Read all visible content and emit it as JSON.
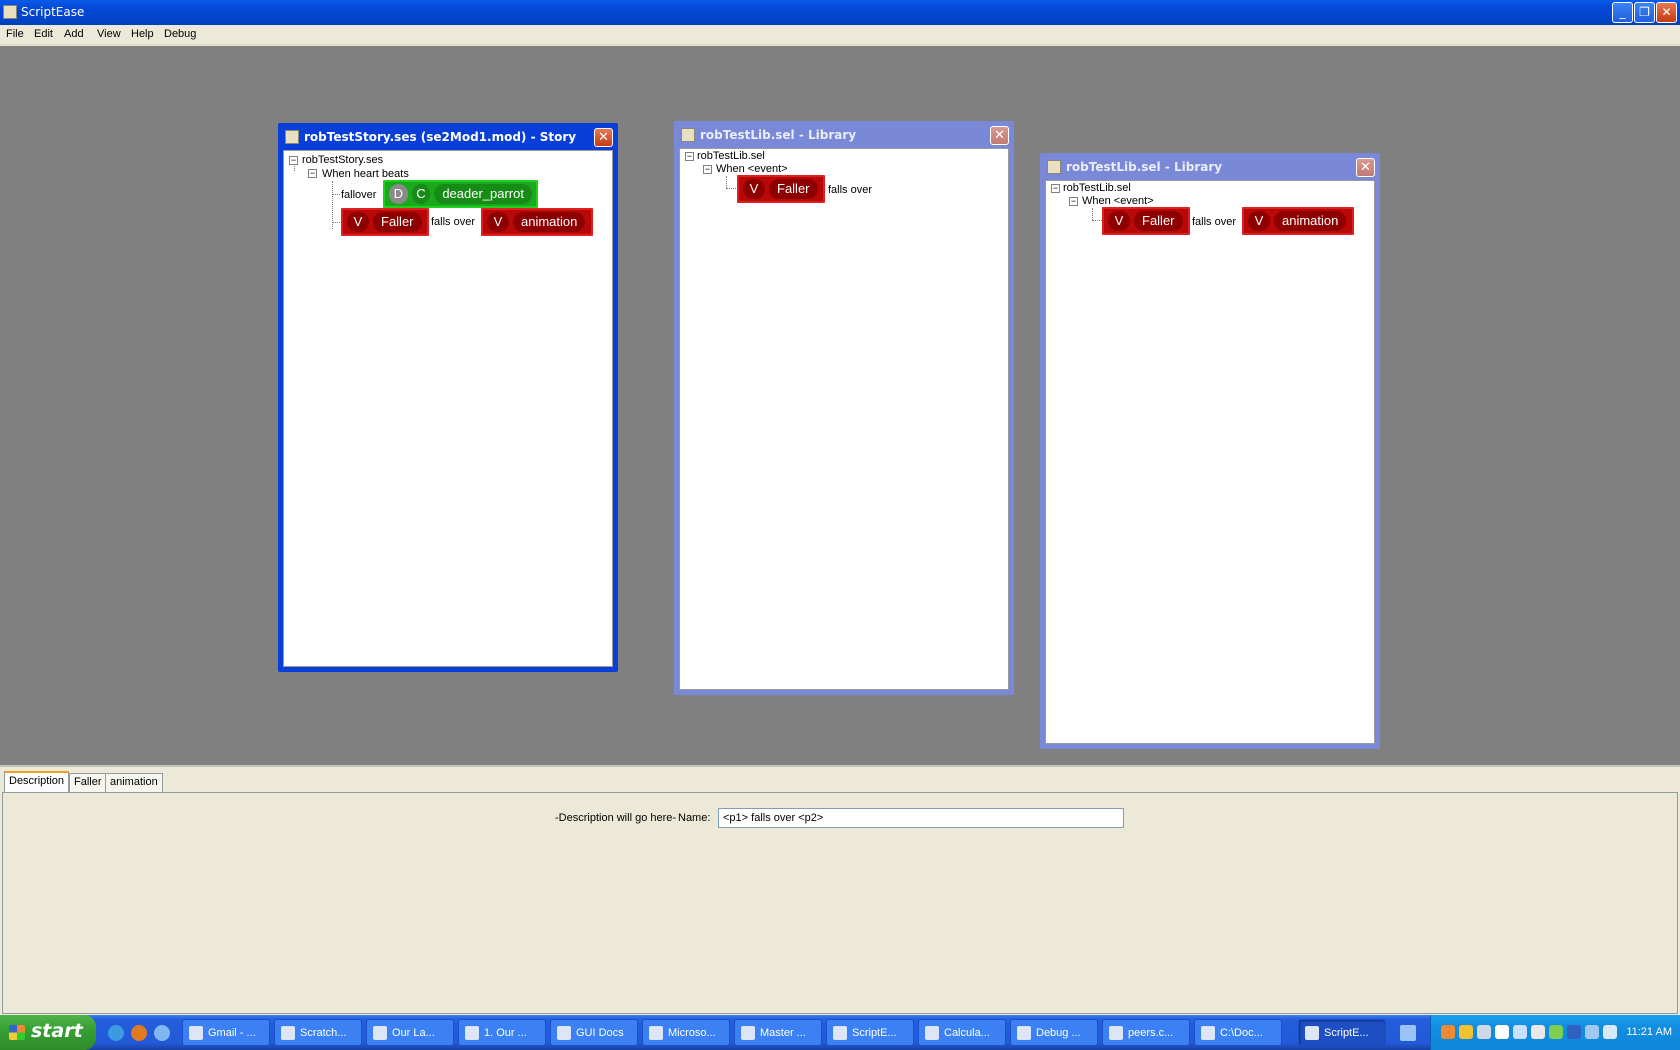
{
  "app": {
    "title": "ScriptEase"
  },
  "window_buttons": {
    "minimize": "_",
    "restore": "❐",
    "close": "✕"
  },
  "menu": [
    "File",
    "Edit",
    "Add",
    "View",
    "Help",
    "Debug"
  ],
  "story_frame": {
    "title": "robTestStory.ses (se2Mod1.mod) - Story",
    "root": "robTestStory.ses",
    "cause": "When heart beats",
    "effect_label": "fallover",
    "green_block": {
      "d": "D",
      "c": "C",
      "name": "deader_parrot"
    },
    "block_v1": "V",
    "block_faller": "Faller",
    "middle_text": "falls over",
    "block_v2": "V",
    "block_animation": "animation"
  },
  "library_frame_1": {
    "title": "robTestLib.sel - Library",
    "root": "robTestLib.sel",
    "cause": "When <event>",
    "block_v": "V",
    "block_faller": "Faller",
    "middle_text": "falls over"
  },
  "library_frame_2": {
    "title": "robTestLib.sel - Library",
    "root": "robTestLib.sel",
    "cause": "When <event>",
    "block_v1": "V",
    "block_faller": "Faller",
    "middle_text": "falls over",
    "block_v2": "V",
    "block_animation": "animation"
  },
  "frame_close": "✕",
  "expander_symbol": "−",
  "bottom_panel": {
    "tabs": [
      "Description",
      "Faller",
      "animation"
    ],
    "selected_tab": "Description",
    "description_text": "-Description will go here-",
    "name_label": "Name:",
    "name_value": "<p1> falls over <p2>"
  },
  "taskbar": {
    "start_label": "start",
    "buttons": [
      "Gmail - ...",
      "Scratch...",
      "Our La...",
      "1. Our ...",
      "GUI Docs",
      "Microso...",
      "Master ...",
      "ScriptE...",
      "Calcula...",
      "Debug ...",
      "peers.c...",
      "C:\\Doc...",
      "ScriptE..."
    ],
    "active_index": 12,
    "clock": "11:21 AM"
  }
}
